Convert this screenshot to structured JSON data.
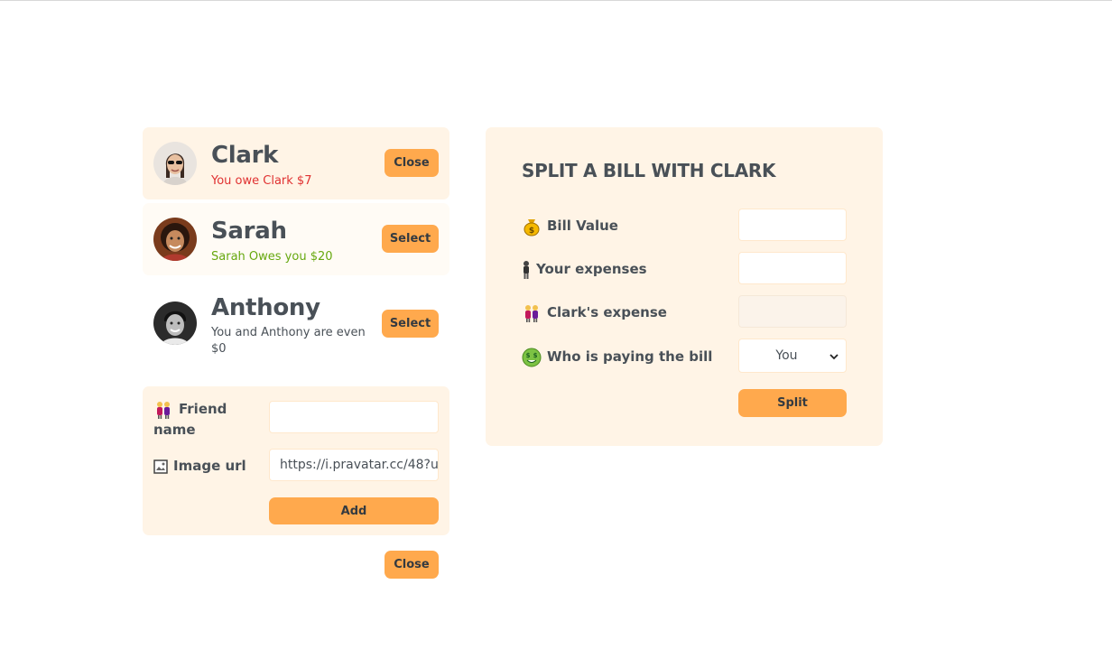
{
  "friends": [
    {
      "name": "Clark",
      "status": "You owe Clark $7",
      "button": "Close"
    },
    {
      "name": "Sarah",
      "status": "Sarah Owes you $20",
      "button": "Select"
    },
    {
      "name": "Anthony",
      "status": "You and Anthony are even $0",
      "button": "Select"
    }
  ],
  "add_form": {
    "friend_name_label": "Friend name",
    "friend_name_value": "",
    "image_url_label": "Image url",
    "image_url_value": "https://i.pravatar.cc/48?u",
    "add_button": "Add"
  },
  "close_button": "Close",
  "split": {
    "title": "SPLIT A BILL WITH CLARK",
    "bill_value_label": "Bill Value",
    "bill_value": "",
    "your_expenses_label": "Your expenses",
    "your_expenses": "",
    "friend_expense_label": "Clark's expense",
    "friend_expense": "",
    "payer_label": "Who is paying the bill",
    "payer_selected": "You",
    "split_button": "Split"
  },
  "colors": {
    "accent": "#ffa94d",
    "panel": "#fff4e6",
    "owe_red": "#e03131",
    "owed_green": "#66a80f"
  },
  "icons": [
    "money-bag-icon",
    "person-standing-icon",
    "two-women-icon",
    "money-mouth-face-icon",
    "framed-picture-icon"
  ]
}
